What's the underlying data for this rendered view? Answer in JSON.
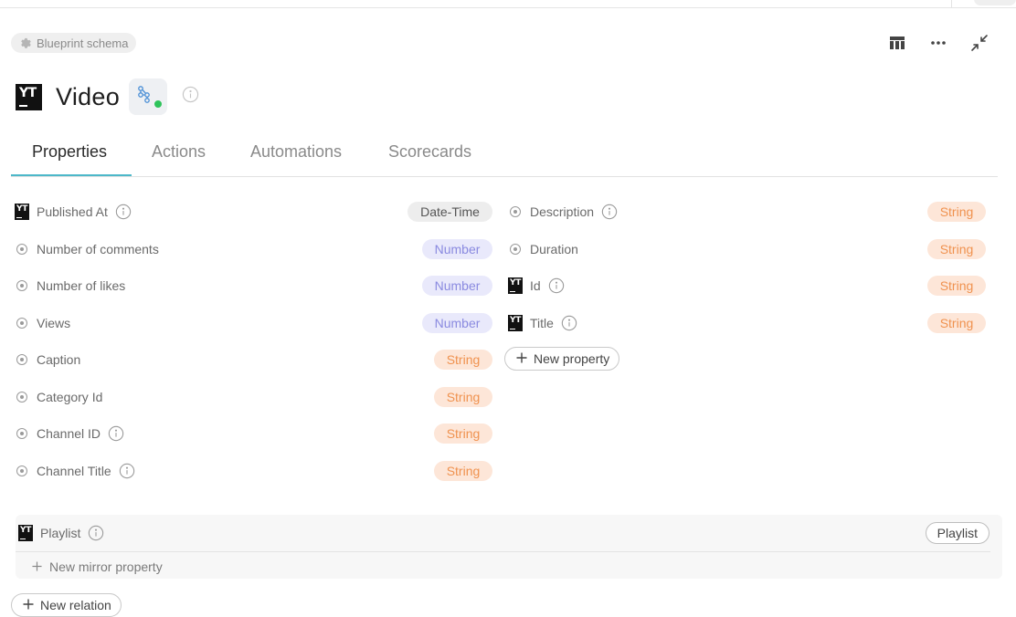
{
  "breadcrumb": {
    "label": "Blueprint schema"
  },
  "blueprint": {
    "title": "Video"
  },
  "tabs": [
    {
      "label": "Properties"
    },
    {
      "label": "Actions"
    },
    {
      "label": "Automations"
    },
    {
      "label": "Scorecards"
    }
  ],
  "properties": {
    "left": [
      {
        "name": "Published At",
        "icon": "youtube-logo",
        "info": true,
        "type": "Date-Time"
      },
      {
        "name": "Number of comments",
        "icon": "radio-dot",
        "info": false,
        "type": "Number"
      },
      {
        "name": "Number of likes",
        "icon": "radio-dot",
        "info": false,
        "type": "Number"
      },
      {
        "name": "Views",
        "icon": "radio-dot",
        "info": false,
        "type": "Number"
      },
      {
        "name": "Caption",
        "icon": "radio-dot",
        "info": false,
        "type": "String"
      },
      {
        "name": "Category Id",
        "icon": "radio-dot",
        "info": false,
        "type": "String"
      },
      {
        "name": "Channel ID",
        "icon": "radio-dot",
        "info": true,
        "type": "String"
      },
      {
        "name": "Channel Title",
        "icon": "radio-dot",
        "info": true,
        "type": "String"
      }
    ],
    "right": [
      {
        "name": "Description",
        "icon": "radio-dot",
        "info": true,
        "type": "String"
      },
      {
        "name": "Duration",
        "icon": "radio-dot",
        "info": false,
        "type": "String"
      },
      {
        "name": "Id",
        "icon": "youtube-logo",
        "info": true,
        "type": "String"
      },
      {
        "name": "Title",
        "icon": "youtube-logo",
        "info": true,
        "type": "String"
      }
    ],
    "new_property_label": "New property"
  },
  "relations": {
    "items": [
      {
        "name": "Playlist",
        "target": "Playlist",
        "mirror_label": "New mirror property"
      }
    ],
    "new_relation_label": "New relation"
  },
  "colors": {
    "tab_accent": "#4db8c9",
    "number_pill_bg": "#e9e9fb",
    "number_pill_text": "#8a8ae0",
    "string_pill_bg": "#fde6d8",
    "string_pill_text": "#f0924f",
    "datetime_pill_bg": "#ededed"
  }
}
